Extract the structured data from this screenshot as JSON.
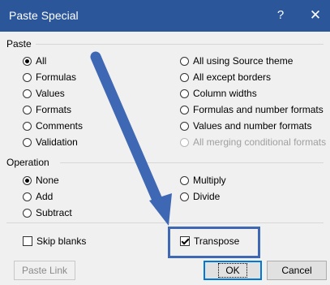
{
  "window": {
    "title": "Paste Special",
    "help": "?",
    "close": "✕"
  },
  "sections": {
    "paste": "Paste",
    "operation": "Operation"
  },
  "paste_options_left": [
    {
      "label": "All",
      "checked": true
    },
    {
      "label": "Formulas",
      "checked": false
    },
    {
      "label": "Values",
      "checked": false
    },
    {
      "label": "Formats",
      "checked": false
    },
    {
      "label": "Comments",
      "checked": false
    },
    {
      "label": "Validation",
      "checked": false
    }
  ],
  "paste_options_right": [
    {
      "label": "All using Source theme",
      "checked": false,
      "enabled": true
    },
    {
      "label": "All except borders",
      "checked": false,
      "enabled": true
    },
    {
      "label": "Column widths",
      "checked": false,
      "enabled": true
    },
    {
      "label": "Formulas and number formats",
      "checked": false,
      "enabled": true
    },
    {
      "label": "Values and number formats",
      "checked": false,
      "enabled": true
    },
    {
      "label": "All merging conditional formats",
      "checked": false,
      "enabled": false
    }
  ],
  "operation_left": [
    {
      "label": "None",
      "checked": true
    },
    {
      "label": "Add",
      "checked": false
    },
    {
      "label": "Subtract",
      "checked": false
    }
  ],
  "operation_right": [
    {
      "label": "Multiply",
      "checked": false
    },
    {
      "label": "Divide",
      "checked": false
    }
  ],
  "checks": {
    "skip_blanks": {
      "label": "Skip blanks",
      "checked": false
    },
    "transpose": {
      "label": "Transpose",
      "checked": true
    }
  },
  "buttons": {
    "paste_link": "Paste Link",
    "ok": "OK",
    "cancel": "Cancel"
  },
  "colors": {
    "titlebar": "#2b579a",
    "annotation": "#3f68b4",
    "focus": "#0078d7"
  }
}
